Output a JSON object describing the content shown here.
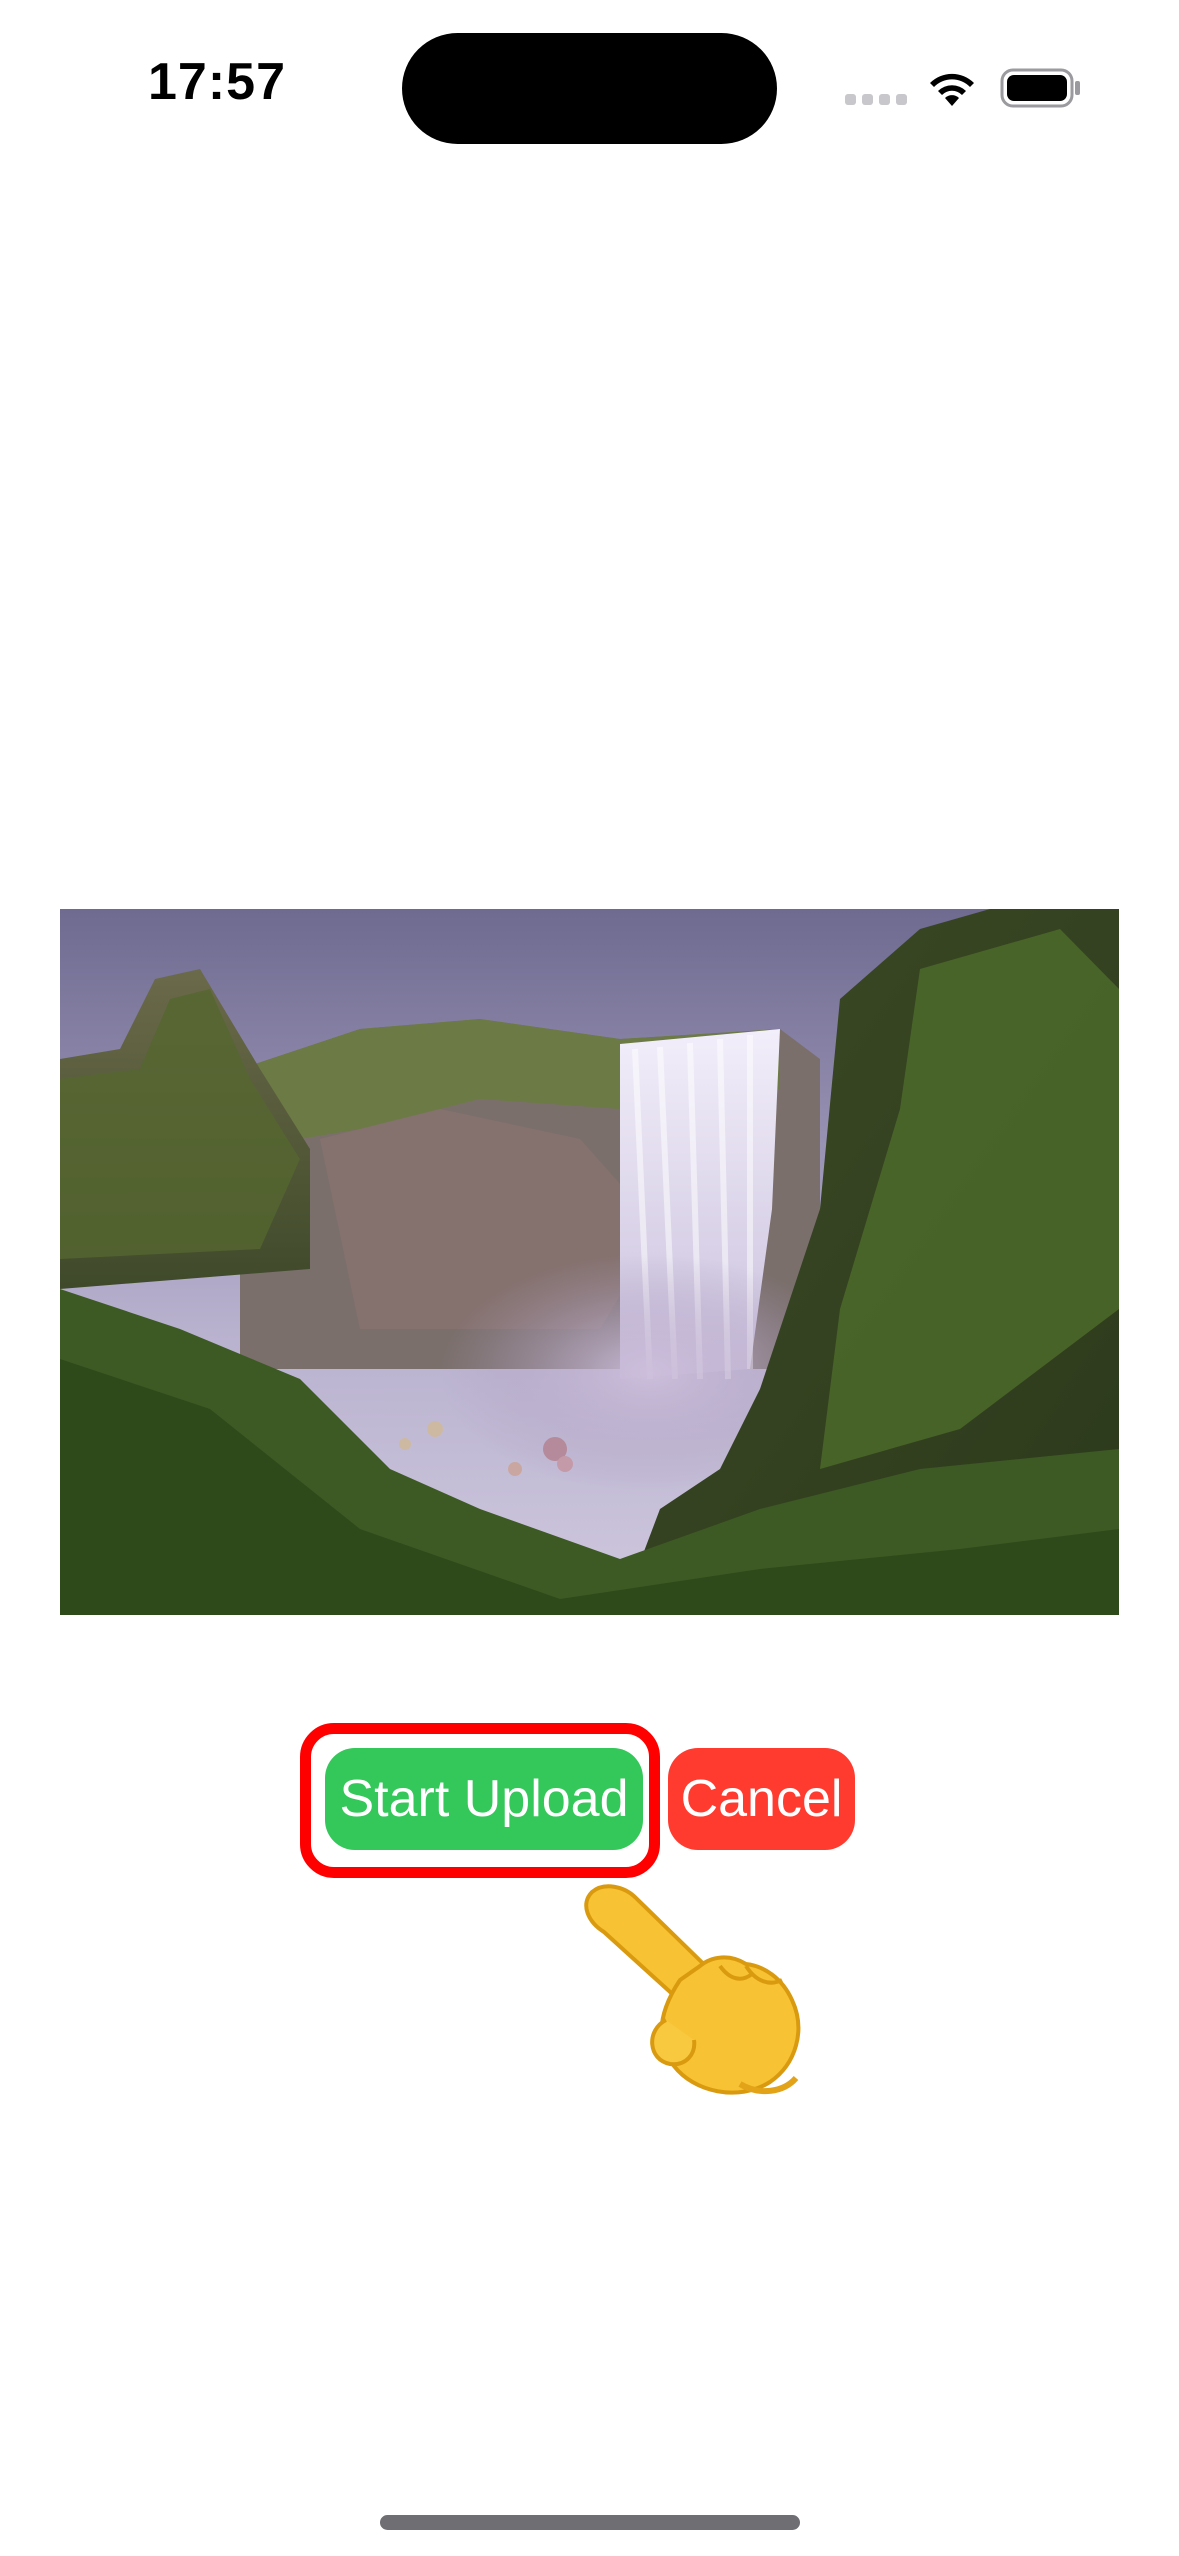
{
  "status_bar": {
    "time": "17:57",
    "icons": [
      "cellular-dots-icon",
      "wifi-icon",
      "battery-icon"
    ]
  },
  "photo": {
    "subject": "waterfall-landscape-image"
  },
  "actions": {
    "start_upload_label": "Start Upload",
    "cancel_label": "Cancel",
    "highlighted": "start_upload"
  },
  "colors": {
    "start_upload": "#34c759",
    "cancel": "#ff3b30",
    "highlight_frame": "#ff0000",
    "background": "#ffffff"
  },
  "pointer": {
    "icon": "pointing-hand-icon"
  }
}
